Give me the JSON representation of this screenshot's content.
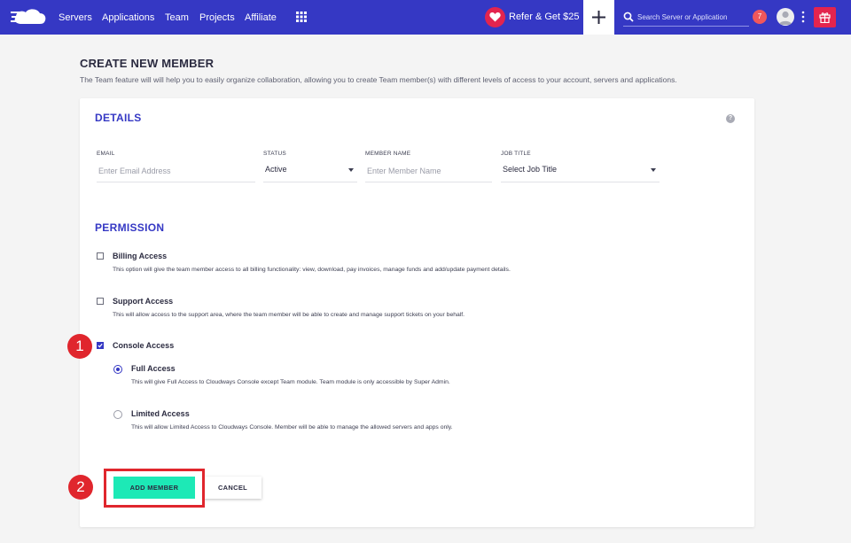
{
  "nav": {
    "items": [
      "Servers",
      "Applications",
      "Team",
      "Projects",
      "Affiliate"
    ],
    "refer_label": "Refer & Get $25",
    "search_placeholder": "Search Server or Application",
    "notification_count": "7"
  },
  "page": {
    "title": "CREATE NEW MEMBER",
    "description": "The Team feature will will help you to easily organize collaboration, allowing you to create Team member(s) with different levels of access to your account, servers and applications."
  },
  "details": {
    "heading": "DETAILS",
    "help": "?",
    "fields": {
      "email": {
        "label": "EMAIL",
        "placeholder": "Enter Email Address"
      },
      "status": {
        "label": "STATUS",
        "value": "Active"
      },
      "member_name": {
        "label": "MEMBER NAME",
        "placeholder": "Enter Member Name"
      },
      "job_title": {
        "label": "JOB TITLE",
        "value": "Select Job Title"
      }
    }
  },
  "permission": {
    "heading": "PERMISSION",
    "billing": {
      "title": "Billing Access",
      "desc": "This option will give the team member access to all billing functionality: view, download, pay invoices, manage funds and add/update payment details.",
      "checked": false
    },
    "support": {
      "title": "Support Access",
      "desc": "This will allow access to the support area, where the team member will be able to create and manage support tickets on your behalf.",
      "checked": false
    },
    "console": {
      "title": "Console Access",
      "checked": true,
      "full": {
        "title": "Full Access",
        "desc": "This will give Full Access to Cloudways Console except Team module. Team module is only accessible by Super Admin.",
        "selected": true
      },
      "limited": {
        "title": "Limited Access",
        "desc": "This will allow Limited Access to Cloudways Console. Member will be able to manage the allowed servers and apps only.",
        "selected": false
      }
    }
  },
  "actions": {
    "add_label": "ADD MEMBER",
    "cancel_label": "CANCEL"
  },
  "annotations": {
    "step1": "1",
    "step2": "2",
    "color": "#e0262d"
  },
  "colors": {
    "brand": "#3538c4",
    "accent_button": "#1de9b6",
    "heart": "#e3244e"
  },
  "icons": [
    "cloud-logo-icon",
    "apps-grid-icon",
    "heart-icon",
    "plus-icon",
    "search-icon",
    "user-avatar-icon",
    "more-vertical-icon",
    "gift-icon",
    "help-icon",
    "check-icon",
    "caret-down-icon"
  ]
}
